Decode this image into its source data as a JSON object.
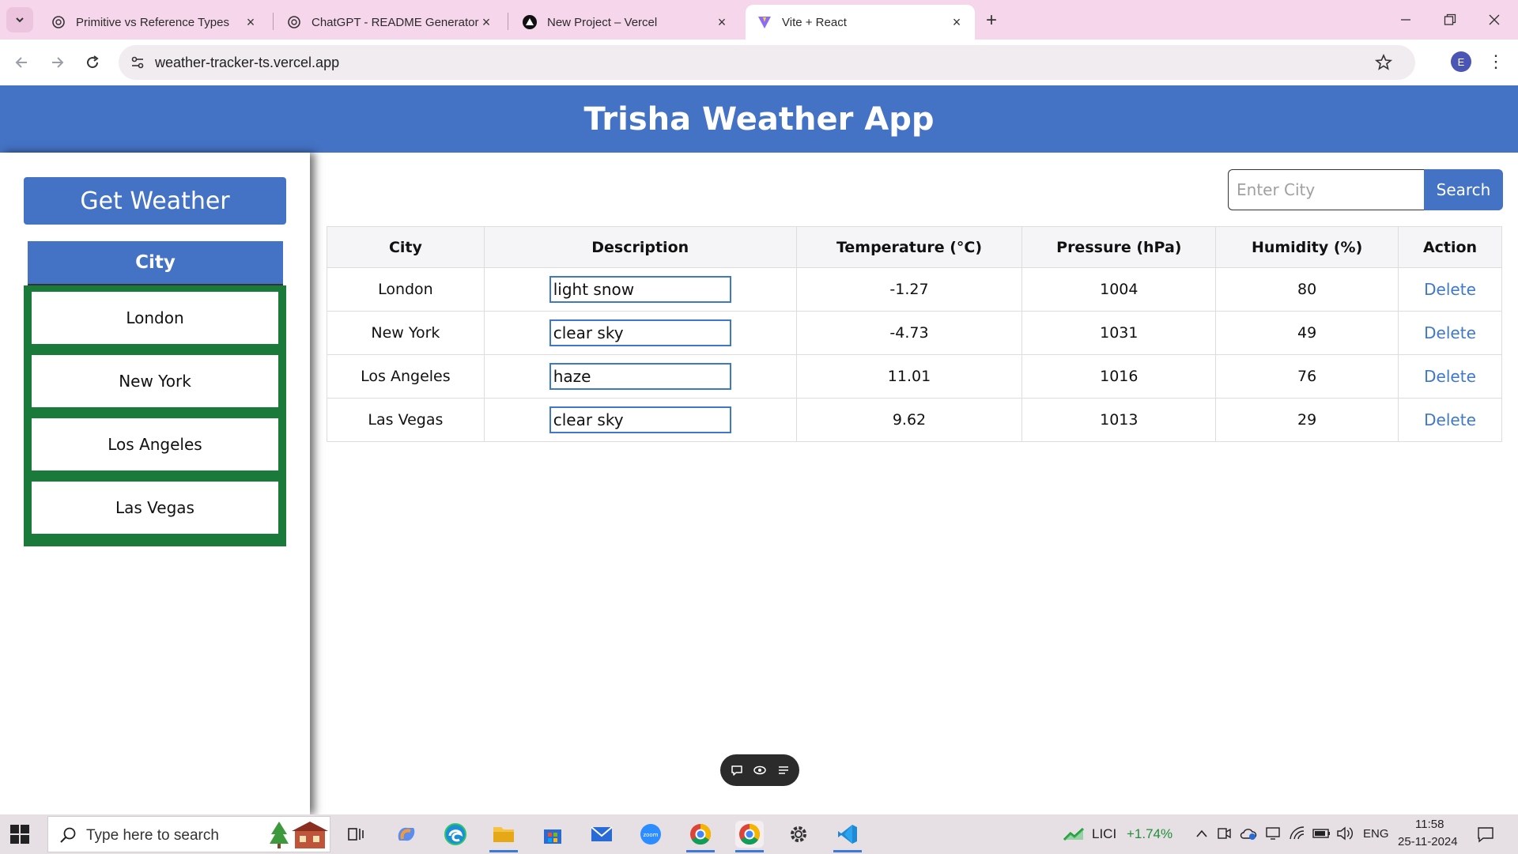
{
  "browser": {
    "tabs": [
      {
        "title": "Primitive vs Reference Types",
        "icon": "chatgpt-icon"
      },
      {
        "title": "ChatGPT - README Generator",
        "icon": "chatgpt-icon"
      },
      {
        "title": "New Project – Vercel",
        "icon": "vercel-icon"
      },
      {
        "title": "Vite + React",
        "icon": "vite-icon",
        "active": true
      }
    ],
    "url": "weather-tracker-ts.vercel.app",
    "profile_initial": "E"
  },
  "app": {
    "title": "Trisha Weather App",
    "get_weather_label": "Get Weather",
    "city_header": "City",
    "cities": [
      "London",
      "New York",
      "Los Angeles",
      "Las Vegas"
    ],
    "search": {
      "placeholder": "Enter City",
      "button": "Search"
    },
    "table": {
      "headers": [
        "City",
        "Description",
        "Temperature (°C)",
        "Pressure (hPa)",
        "Humidity (%)",
        "Action"
      ],
      "rows": [
        {
          "city": "London",
          "description": "light snow",
          "temperature": "-1.27",
          "pressure": "1004",
          "humidity": "80",
          "action": "Delete"
        },
        {
          "city": "New York",
          "description": "clear sky",
          "temperature": "-4.73",
          "pressure": "1031",
          "humidity": "49",
          "action": "Delete"
        },
        {
          "city": "Los Angeles",
          "description": "haze",
          "temperature": "11.01",
          "pressure": "1016",
          "humidity": "76",
          "action": "Delete"
        },
        {
          "city": "Las Vegas",
          "description": "clear sky",
          "temperature": "9.62",
          "pressure": "1013",
          "humidity": "29",
          "action": "Delete"
        }
      ]
    }
  },
  "taskbar": {
    "search_placeholder": "Type here to search",
    "stock": {
      "name": "LICI",
      "change": "+1.74%"
    },
    "language": "ENG",
    "time": "11:58",
    "date": "25-11-2024"
  },
  "colors": {
    "accent": "#4472c4",
    "green": "#1a7a3a",
    "link": "#3f78c8",
    "tab_bar": "#f6d6ea"
  }
}
